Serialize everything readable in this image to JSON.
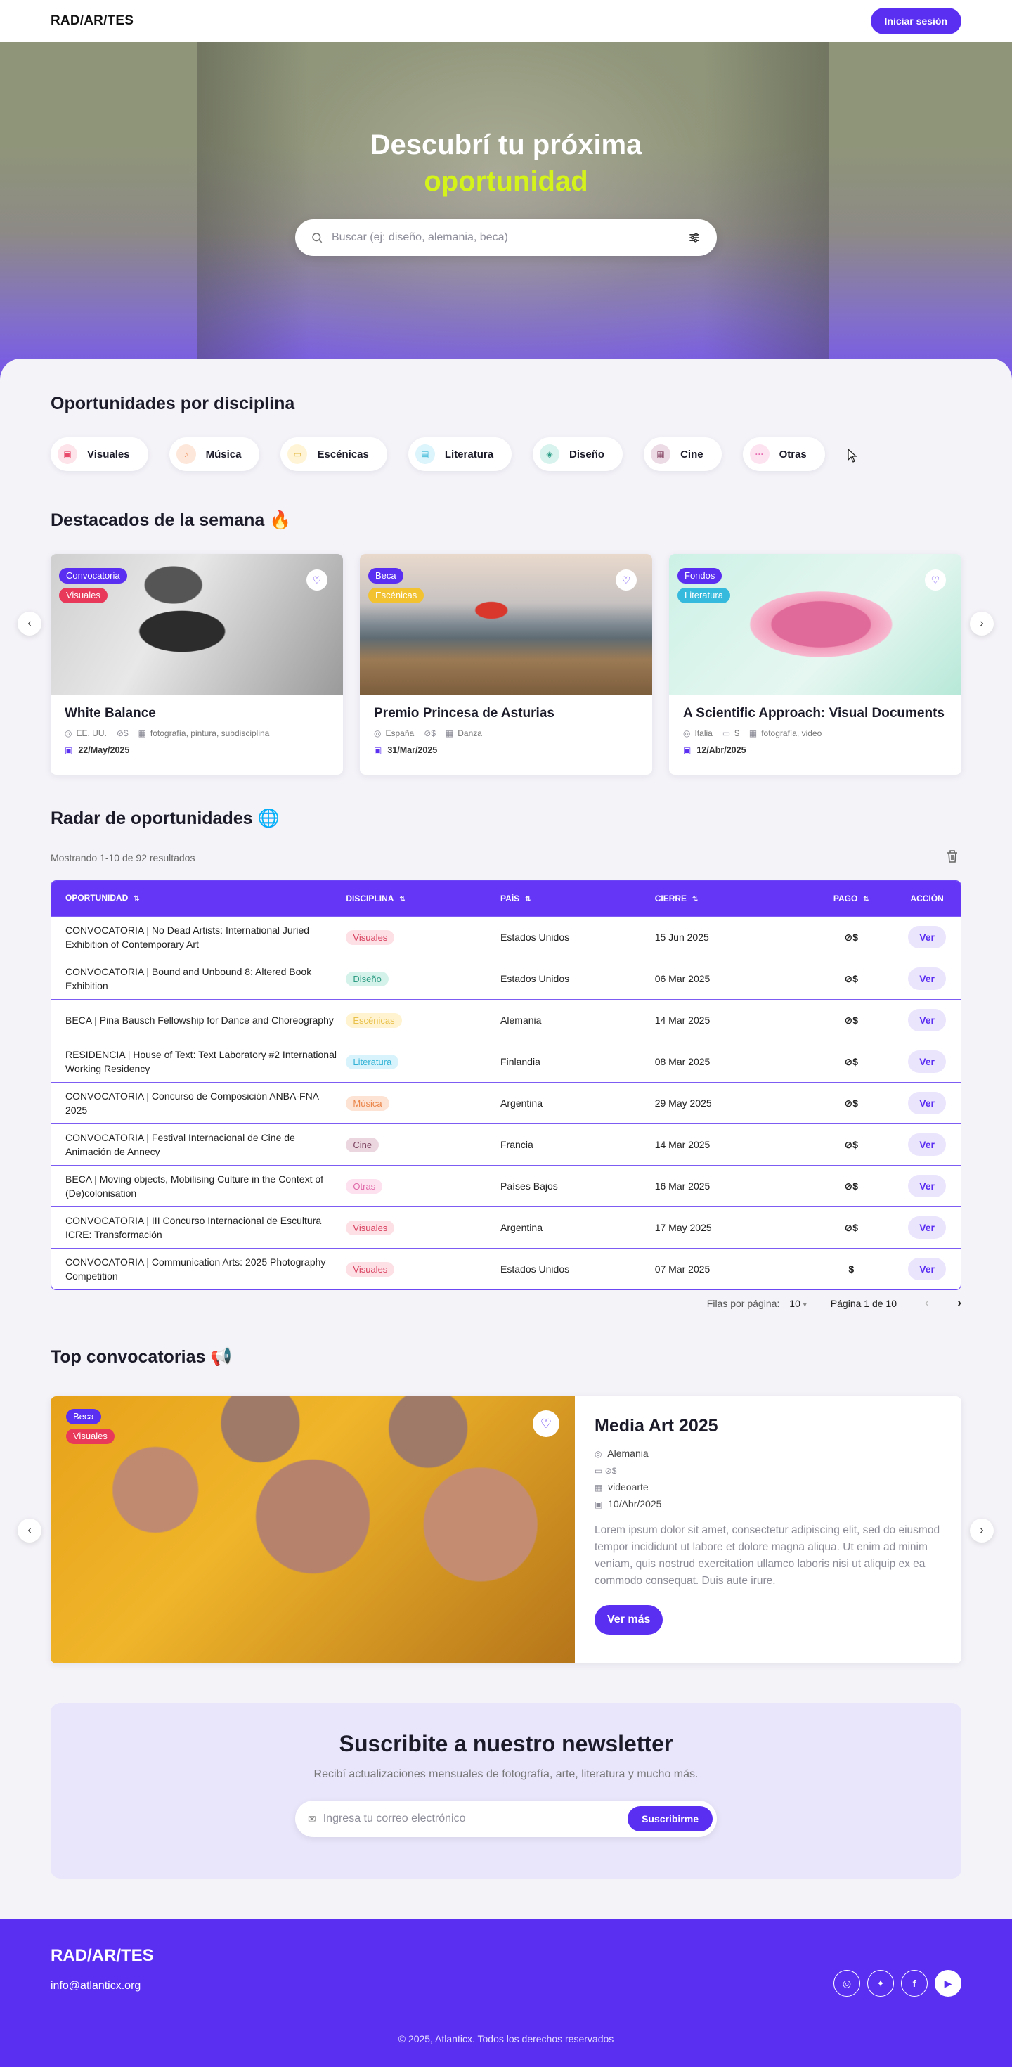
{
  "nav": {
    "logo": "RAD/AR/TES",
    "login": "Iniciar sesión"
  },
  "hero": {
    "title_line1": "Descubrí tu próxima",
    "title_line2": "oportunidad",
    "search_placeholder": "Buscar (ej: diseño, alemania, beca)"
  },
  "disciplines": {
    "title": "Oportunidades por disciplina",
    "items": [
      {
        "label": "Visuales",
        "bg": "#fde3ea",
        "fg": "#e84a6b"
      },
      {
        "label": "Música",
        "bg": "#fde7da",
        "fg": "#ef8a52"
      },
      {
        "label": "Escénicas",
        "bg": "#fff5d6",
        "fg": "#e2b33a"
      },
      {
        "label": "Literatura",
        "bg": "#dcf4fb",
        "fg": "#3bb8d8"
      },
      {
        "label": "Diseño",
        "bg": "#d8f3ed",
        "fg": "#2e9e88"
      },
      {
        "label": "Cine",
        "bg": "#ecdbe4",
        "fg": "#8a4a68"
      },
      {
        "label": "Otras",
        "bg": "#fde3f0",
        "fg": "#e66bb0"
      }
    ]
  },
  "featured": {
    "title": "Destacados de la semana 🔥",
    "cards": [
      {
        "tag1": "Convocatoria",
        "tag2": "Visuales",
        "tag2_color": "#e8395b",
        "title": "White Balance",
        "country": "EE. UU.",
        "disciplines": "fotografía, pintura, subdisciplina",
        "date": "22/May/2025",
        "pay": ""
      },
      {
        "tag1": "Beca",
        "tag2": "Escénicas",
        "tag2_color": "#f2c230",
        "title": "Premio Princesa de Asturias",
        "country": "España",
        "disciplines": "Danza",
        "date": "31/Mar/2025",
        "pay": ""
      },
      {
        "tag1": "Fondos",
        "tag2": "Literatura",
        "tag2_color": "#35b9dc",
        "title": "A Scientific Approach: Visual Documents",
        "country": "Italia",
        "disciplines": "fotografía, video",
        "date": "12/Abr/2025",
        "pay": "$"
      }
    ]
  },
  "radar": {
    "title": "Radar de oportunidades 🌐",
    "showing": "Mostrando 1-10 de 92 resultados",
    "headers": [
      "OPORTUNIDAD",
      "DISCIPLINA",
      "PAÍS",
      "CIERRE",
      "PAGO",
      "ACCIÓN"
    ],
    "rows": [
      {
        "name": "CONVOCATORIA | No Dead Artists: International Juried Exhibition of Contemporary Art",
        "disc": "Visuales",
        "bg": "#fde0e6",
        "fg": "#d8415f",
        "country": "Estados Unidos",
        "close": "15 Jun 2025",
        "pay": "⊘$",
        "action": "Ver"
      },
      {
        "name": "CONVOCATORIA | Bound and Unbound 8: Altered Book Exhibition",
        "disc": "Diseño",
        "bg": "#d5f2ea",
        "fg": "#2f9c84",
        "country": "Estados Unidos",
        "close": "06 Mar 2025",
        "pay": "⊘$",
        "action": "Ver"
      },
      {
        "name": "BECA | Pina Bausch Fellowship for Dance and Choreography",
        "disc": "Escénicas",
        "bg": "#fff3d0",
        "fg": "#e8c04a",
        "country": "Alemania",
        "close": "14 Mar 2025",
        "pay": "⊘$",
        "action": "Ver"
      },
      {
        "name": "RESIDENCIA | House of Text: Text Laboratory #2 International Working Residency",
        "disc": "Literatura",
        "bg": "#d8f3fb",
        "fg": "#34b3d6",
        "country": "Finlandia",
        "close": "08 Mar 2025",
        "pay": "⊘$",
        "action": "Ver"
      },
      {
        "name": "CONVOCATORIA | Concurso de Composición ANBA-FNA 2025",
        "disc": "Música",
        "bg": "#fde3d3",
        "fg": "#ea8448",
        "country": "Argentina",
        "close": "29 May 2025",
        "pay": "⊘$",
        "action": "Ver"
      },
      {
        "name": "CONVOCATORIA | Festival Internacional de Cine de Animación de Annecy",
        "disc": "Cine",
        "bg": "#ebd6df",
        "fg": "#7d4360",
        "country": "Francia",
        "close": "14 Mar 2025",
        "pay": "⊘$",
        "action": "Ver"
      },
      {
        "name": "BECA | Moving objects, Mobilising Culture in the Context of (De)colonisation",
        "disc": "Otras",
        "bg": "#fde1ef",
        "fg": "#e06aaa",
        "country": "Países Bajos",
        "close": "16 Mar 2025",
        "pay": "⊘$",
        "action": "Ver"
      },
      {
        "name": "CONVOCATORIA | III Concurso Internacional de Escultura ICRE: Transformación",
        "disc": "Visuales",
        "bg": "#fde0e6",
        "fg": "#d8415f",
        "country": "Argentina",
        "close": "17 May 2025",
        "pay": "⊘$",
        "action": "Ver"
      },
      {
        "name": "CONVOCATORIA | Communication Arts: 2025 Photography Competition",
        "disc": "Visuales",
        "bg": "#fde0e6",
        "fg": "#d8415f",
        "country": "Estados Unidos",
        "close": "07 Mar 2025",
        "pay": "$",
        "action": "Ver"
      }
    ],
    "rows_per_page_label": "Filas por página:",
    "rows_per_page": "10",
    "page_label": "Página 1 de 10"
  },
  "top": {
    "title": "Top convocatorias 📢",
    "tag1": "Beca",
    "tag2": "Visuales",
    "name": "Media Art 2025",
    "country": "Alemania",
    "disciplines": "videoarte",
    "date": "10/Abr/2025",
    "description": "Lorem ipsum dolor sit amet, consectetur adipiscing elit, sed do eiusmod tempor incididunt ut labore et dolore magna aliqua. Ut enim ad minim veniam, quis nostrud exercitation ullamco laboris nisi ut aliquip ex ea commodo consequat. Duis aute irure.",
    "cta": "Ver más"
  },
  "newsletter": {
    "title": "Suscribite a nuestro newsletter",
    "subtitle": "Recibí actualizaciones mensuales de fotografía, arte, literatura y mucho más.",
    "placeholder": "Ingresa tu correo electrónico",
    "button": "Suscribirme"
  },
  "footer": {
    "logo": "RAD/AR/TES",
    "email": "info@atlanticx.org",
    "copyright": "© 2025, Atlanticx. Todos los derechos reservados",
    "social": [
      "instagram-icon",
      "twitter-icon",
      "facebook-icon",
      "youtube-icon"
    ]
  }
}
